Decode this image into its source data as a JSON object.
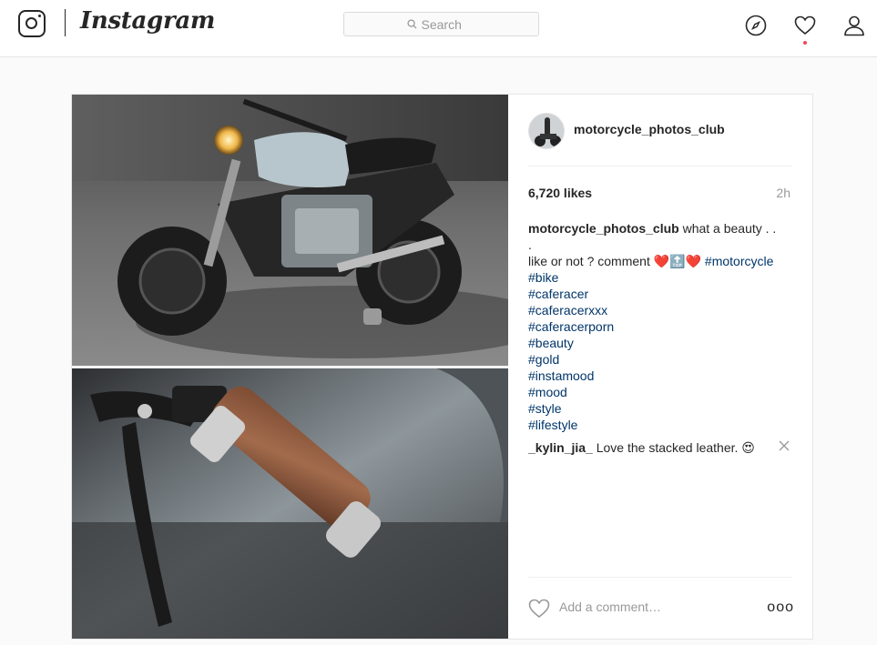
{
  "app": {
    "wordmark": "Instagram"
  },
  "search": {
    "placeholder": "Search"
  },
  "nav": {
    "icons": [
      "explore-compass-icon",
      "activity-heart-icon",
      "profile-person-icon"
    ]
  },
  "post": {
    "image_alt": "motorcycle photo",
    "username": "motorcycle_photos_club",
    "likes": "6,720 likes",
    "time": "2h",
    "caption": {
      "user": "motorcycle_photos_club",
      "text_line1": "what a beauty . .",
      "text_line2": ".",
      "text_line3": "like or not ? comment ❤️🔝❤️",
      "inline_tag": "#motorcycle",
      "tags": [
        "#bike",
        "#caferacer",
        "#caferacerxxx",
        "#caferacerporn",
        "#beauty",
        "#gold",
        "#instamood",
        "#mood",
        "#style",
        "#lifestyle"
      ]
    },
    "comments": [
      {
        "user": "_kylin_jia_",
        "text": "Love the stacked leather. 😍"
      }
    ],
    "add_comment": {
      "placeholder": "Add a comment…"
    },
    "more_label": "ooo"
  },
  "colors": {
    "hashtag": "#003569",
    "notification_dot": "#ed4956",
    "border": "#e6e6e6"
  }
}
